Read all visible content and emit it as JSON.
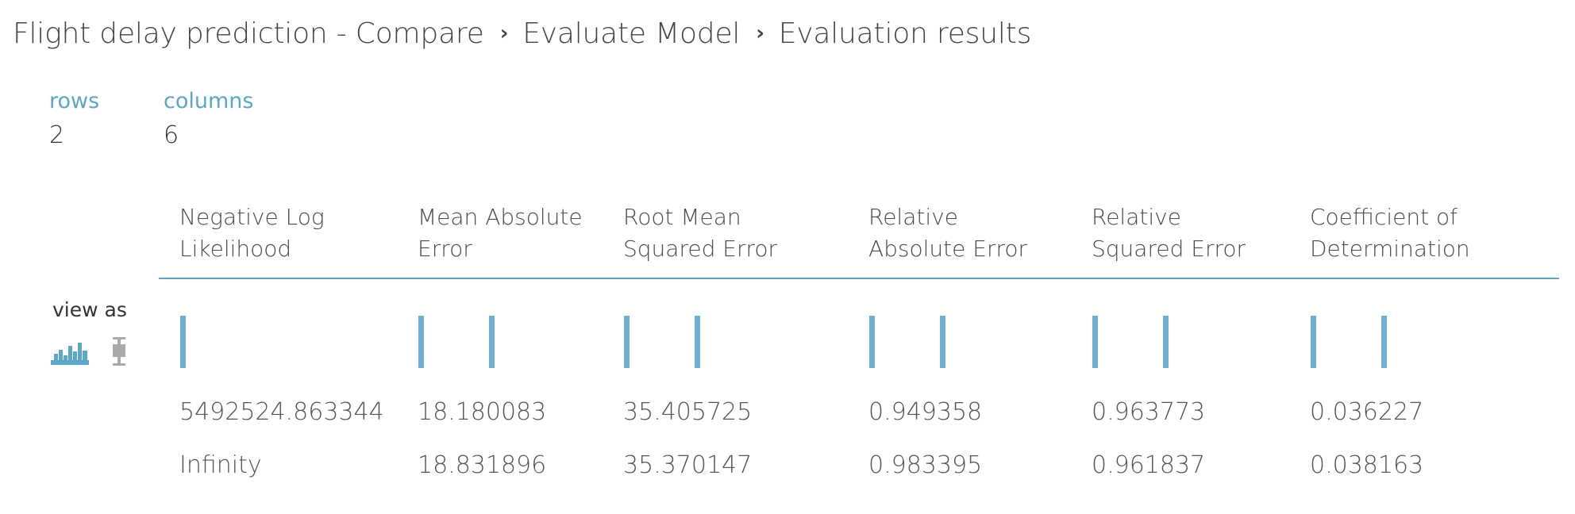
{
  "breadcrumb": {
    "items": [
      "Flight delay prediction - Compare",
      "Evaluate Model",
      "Evaluation results"
    ],
    "separator": "›"
  },
  "stats": {
    "rows_label": "rows",
    "rows_value": "2",
    "columns_label": "columns",
    "columns_value": "6"
  },
  "view_as": {
    "label": "view as",
    "icons": [
      "histogram-icon",
      "boxplot-icon"
    ]
  },
  "columns": [
    {
      "line1": "Negative Log",
      "line2": "Likelihood"
    },
    {
      "line1": "Mean Absolute",
      "line2": "Error"
    },
    {
      "line1": "Root Mean",
      "line2": "Squared Error"
    },
    {
      "line1": "Relative",
      "line2": "Absolute Error"
    },
    {
      "line1": "Relative",
      "line2": "Squared Error"
    },
    {
      "line1": "Coefficient of",
      "line2": "Determination"
    }
  ],
  "rows": [
    [
      "5492524.863344",
      "18.180083",
      "35.405725",
      "0.949358",
      "0.963773",
      "0.036227"
    ],
    [
      "Infinity",
      "18.831896",
      "35.370147",
      "0.983395",
      "0.961837",
      "0.038163"
    ]
  ],
  "colors": {
    "accent": "#5aa7c8",
    "spark": "#6fb0d2",
    "inactive_icon": "#aaaaaa"
  }
}
